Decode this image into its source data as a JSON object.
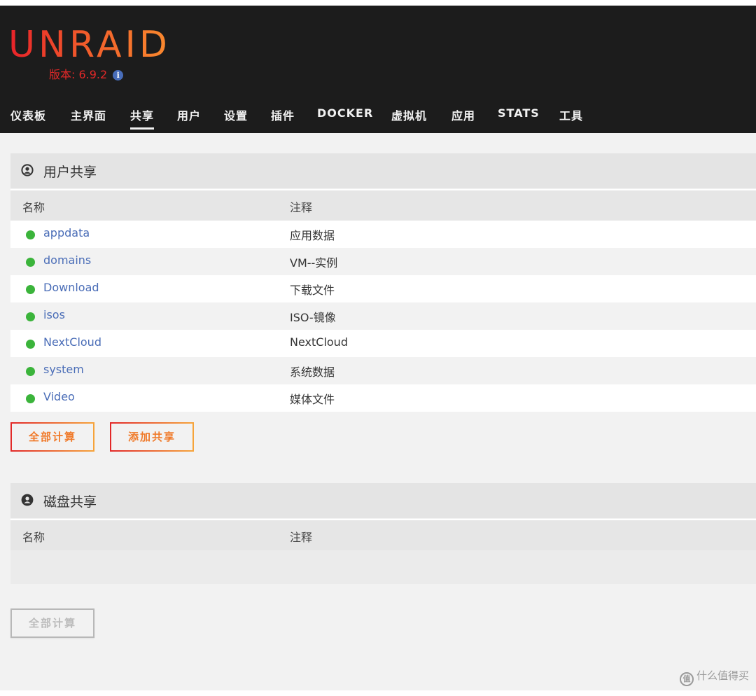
{
  "app": {
    "logo": "UNRAID",
    "version": "版本: 6.9.2",
    "info_icon": "info-circle-icon"
  },
  "nav": {
    "items": [
      {
        "label": "仪表板"
      },
      {
        "label": "主界面"
      },
      {
        "label": "共享",
        "active": true
      },
      {
        "label": "用户"
      },
      {
        "label": "设置"
      },
      {
        "label": "插件"
      },
      {
        "label": "DOCKER"
      },
      {
        "label": "虚拟机"
      },
      {
        "label": "应用"
      },
      {
        "label": "STATS"
      },
      {
        "label": "工具"
      }
    ]
  },
  "user_shares": {
    "title": "用户共享",
    "icon": "user-circle-icon",
    "columns": {
      "name": "名称",
      "comment": "注释"
    },
    "rows": [
      {
        "name": "appdata",
        "comment": "应用数据",
        "status": "green"
      },
      {
        "name": "domains",
        "comment": "VM--实例",
        "status": "green"
      },
      {
        "name": "Download",
        "comment": "下载文件",
        "status": "green"
      },
      {
        "name": "isos",
        "comment": "ISO-镜像",
        "status": "green"
      },
      {
        "name": "NextCloud",
        "comment": "NextCloud",
        "status": "green"
      },
      {
        "name": "system",
        "comment": "系统数据",
        "status": "green"
      },
      {
        "name": "Video",
        "comment": "媒体文件",
        "status": "green"
      }
    ],
    "buttons": {
      "compute_all": "全部计算",
      "add_share": "添加共享"
    }
  },
  "disk_shares": {
    "title": "磁盘共享",
    "icon": "user-circle-filled-icon",
    "columns": {
      "name": "名称",
      "comment": "注释"
    },
    "buttons": {
      "compute_all": "全部计算"
    }
  },
  "watermark": {
    "text": "什么值得买",
    "icon": "smzdm-logo-icon"
  },
  "colors": {
    "header_bg": "#1c1c1c",
    "accent_red": "#e22828",
    "accent_orange": "#f6a43a",
    "link": "#4a6db7",
    "status_green": "#3bb43b"
  }
}
